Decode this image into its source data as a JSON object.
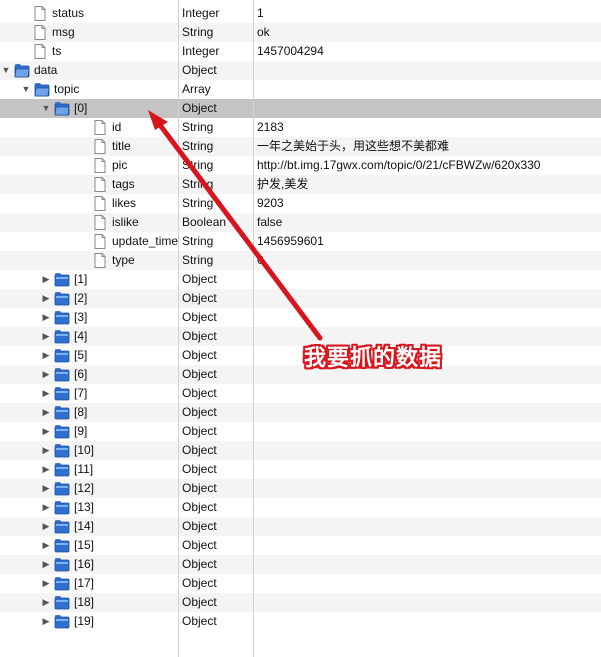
{
  "colors": {
    "selected_row": "#c4c4c4",
    "alt_row": "#f4f4f4",
    "folder_blue": "#2f6fd0",
    "annotation_red": "#d8141c"
  },
  "annotation": {
    "text": "我要抓的数据",
    "arrow_target_row": "[0]"
  },
  "rows": [
    {
      "key": "status",
      "type": "Integer",
      "value": "1",
      "depth": 0,
      "node": "leaf"
    },
    {
      "key": "msg",
      "type": "String",
      "value": "ok",
      "depth": 0,
      "node": "leaf"
    },
    {
      "key": "ts",
      "type": "Integer",
      "value": "1457004294",
      "depth": 0,
      "node": "leaf"
    },
    {
      "key": "data",
      "type": "Object",
      "value": "",
      "depth": 0,
      "node": "folder",
      "expanded": true
    },
    {
      "key": "topic",
      "type": "Array",
      "value": "",
      "depth": 1,
      "node": "folder",
      "expanded": true
    },
    {
      "key": "[0]",
      "type": "Object",
      "value": "",
      "depth": 2,
      "node": "folder",
      "expanded": true,
      "selected": true
    },
    {
      "key": "id",
      "type": "String",
      "value": "2183",
      "depth": 3,
      "node": "leaf"
    },
    {
      "key": "title",
      "type": "String",
      "value": "一年之美始于头，用这些想不美都难",
      "depth": 3,
      "node": "leaf"
    },
    {
      "key": "pic",
      "type": "String",
      "value": "http://bt.img.17gwx.com/topic/0/21/cFBWZw/620x330",
      "depth": 3,
      "node": "leaf"
    },
    {
      "key": "tags",
      "type": "String",
      "value": "护发,美发",
      "depth": 3,
      "node": "leaf"
    },
    {
      "key": "likes",
      "type": "String",
      "value": "9203",
      "depth": 3,
      "node": "leaf"
    },
    {
      "key": "islike",
      "type": "Boolean",
      "value": "false",
      "depth": 3,
      "node": "leaf"
    },
    {
      "key": "update_time",
      "type": "String",
      "value": "1456959601",
      "depth": 3,
      "node": "leaf"
    },
    {
      "key": "type",
      "type": "String",
      "value": "0",
      "depth": 3,
      "node": "leaf"
    },
    {
      "key": "[1]",
      "type": "Object",
      "value": "",
      "depth": 2,
      "node": "folder",
      "expanded": false
    },
    {
      "key": "[2]",
      "type": "Object",
      "value": "",
      "depth": 2,
      "node": "folder",
      "expanded": false
    },
    {
      "key": "[3]",
      "type": "Object",
      "value": "",
      "depth": 2,
      "node": "folder",
      "expanded": false
    },
    {
      "key": "[4]",
      "type": "Object",
      "value": "",
      "depth": 2,
      "node": "folder",
      "expanded": false
    },
    {
      "key": "[5]",
      "type": "Object",
      "value": "",
      "depth": 2,
      "node": "folder",
      "expanded": false
    },
    {
      "key": "[6]",
      "type": "Object",
      "value": "",
      "depth": 2,
      "node": "folder",
      "expanded": false
    },
    {
      "key": "[7]",
      "type": "Object",
      "value": "",
      "depth": 2,
      "node": "folder",
      "expanded": false
    },
    {
      "key": "[8]",
      "type": "Object",
      "value": "",
      "depth": 2,
      "node": "folder",
      "expanded": false
    },
    {
      "key": "[9]",
      "type": "Object",
      "value": "",
      "depth": 2,
      "node": "folder",
      "expanded": false
    },
    {
      "key": "[10]",
      "type": "Object",
      "value": "",
      "depth": 2,
      "node": "folder",
      "expanded": false
    },
    {
      "key": "[11]",
      "type": "Object",
      "value": "",
      "depth": 2,
      "node": "folder",
      "expanded": false
    },
    {
      "key": "[12]",
      "type": "Object",
      "value": "",
      "depth": 2,
      "node": "folder",
      "expanded": false
    },
    {
      "key": "[13]",
      "type": "Object",
      "value": "",
      "depth": 2,
      "node": "folder",
      "expanded": false
    },
    {
      "key": "[14]",
      "type": "Object",
      "value": "",
      "depth": 2,
      "node": "folder",
      "expanded": false
    },
    {
      "key": "[15]",
      "type": "Object",
      "value": "",
      "depth": 2,
      "node": "folder",
      "expanded": false
    },
    {
      "key": "[16]",
      "type": "Object",
      "value": "",
      "depth": 2,
      "node": "folder",
      "expanded": false
    },
    {
      "key": "[17]",
      "type": "Object",
      "value": "",
      "depth": 2,
      "node": "folder",
      "expanded": false
    },
    {
      "key": "[18]",
      "type": "Object",
      "value": "",
      "depth": 2,
      "node": "folder",
      "expanded": false
    },
    {
      "key": "[19]",
      "type": "Object",
      "value": "",
      "depth": 2,
      "node": "folder",
      "expanded": false
    }
  ]
}
